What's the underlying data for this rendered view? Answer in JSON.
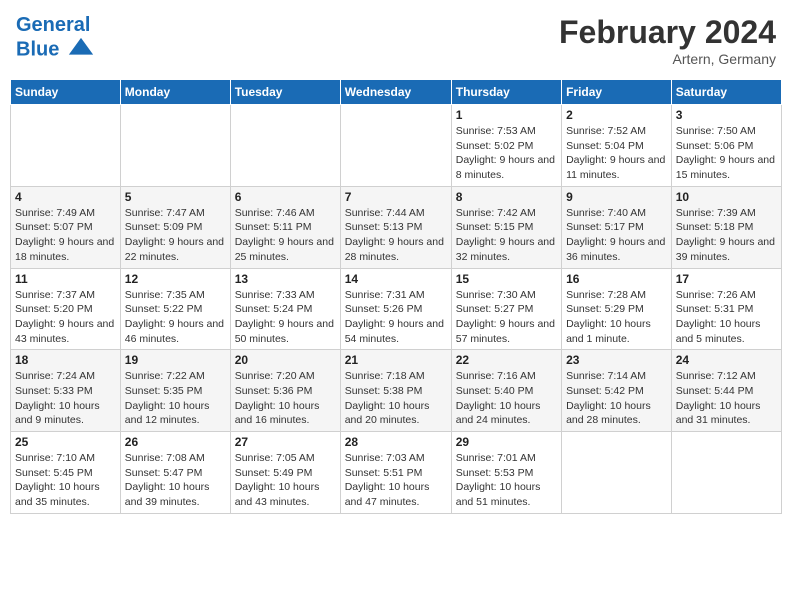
{
  "header": {
    "logo_line1": "General",
    "logo_line2": "Blue",
    "title": "February 2024",
    "subtitle": "Artern, Germany"
  },
  "weekdays": [
    "Sunday",
    "Monday",
    "Tuesday",
    "Wednesday",
    "Thursday",
    "Friday",
    "Saturday"
  ],
  "weeks": [
    [
      {
        "day": "",
        "sunrise": "",
        "sunset": "",
        "daylight": ""
      },
      {
        "day": "",
        "sunrise": "",
        "sunset": "",
        "daylight": ""
      },
      {
        "day": "",
        "sunrise": "",
        "sunset": "",
        "daylight": ""
      },
      {
        "day": "",
        "sunrise": "",
        "sunset": "",
        "daylight": ""
      },
      {
        "day": "1",
        "sunrise": "Sunrise: 7:53 AM",
        "sunset": "Sunset: 5:02 PM",
        "daylight": "Daylight: 9 hours and 8 minutes."
      },
      {
        "day": "2",
        "sunrise": "Sunrise: 7:52 AM",
        "sunset": "Sunset: 5:04 PM",
        "daylight": "Daylight: 9 hours and 11 minutes."
      },
      {
        "day": "3",
        "sunrise": "Sunrise: 7:50 AM",
        "sunset": "Sunset: 5:06 PM",
        "daylight": "Daylight: 9 hours and 15 minutes."
      }
    ],
    [
      {
        "day": "4",
        "sunrise": "Sunrise: 7:49 AM",
        "sunset": "Sunset: 5:07 PM",
        "daylight": "Daylight: 9 hours and 18 minutes."
      },
      {
        "day": "5",
        "sunrise": "Sunrise: 7:47 AM",
        "sunset": "Sunset: 5:09 PM",
        "daylight": "Daylight: 9 hours and 22 minutes."
      },
      {
        "day": "6",
        "sunrise": "Sunrise: 7:46 AM",
        "sunset": "Sunset: 5:11 PM",
        "daylight": "Daylight: 9 hours and 25 minutes."
      },
      {
        "day": "7",
        "sunrise": "Sunrise: 7:44 AM",
        "sunset": "Sunset: 5:13 PM",
        "daylight": "Daylight: 9 hours and 28 minutes."
      },
      {
        "day": "8",
        "sunrise": "Sunrise: 7:42 AM",
        "sunset": "Sunset: 5:15 PM",
        "daylight": "Daylight: 9 hours and 32 minutes."
      },
      {
        "day": "9",
        "sunrise": "Sunrise: 7:40 AM",
        "sunset": "Sunset: 5:17 PM",
        "daylight": "Daylight: 9 hours and 36 minutes."
      },
      {
        "day": "10",
        "sunrise": "Sunrise: 7:39 AM",
        "sunset": "Sunset: 5:18 PM",
        "daylight": "Daylight: 9 hours and 39 minutes."
      }
    ],
    [
      {
        "day": "11",
        "sunrise": "Sunrise: 7:37 AM",
        "sunset": "Sunset: 5:20 PM",
        "daylight": "Daylight: 9 hours and 43 minutes."
      },
      {
        "day": "12",
        "sunrise": "Sunrise: 7:35 AM",
        "sunset": "Sunset: 5:22 PM",
        "daylight": "Daylight: 9 hours and 46 minutes."
      },
      {
        "day": "13",
        "sunrise": "Sunrise: 7:33 AM",
        "sunset": "Sunset: 5:24 PM",
        "daylight": "Daylight: 9 hours and 50 minutes."
      },
      {
        "day": "14",
        "sunrise": "Sunrise: 7:31 AM",
        "sunset": "Sunset: 5:26 PM",
        "daylight": "Daylight: 9 hours and 54 minutes."
      },
      {
        "day": "15",
        "sunrise": "Sunrise: 7:30 AM",
        "sunset": "Sunset: 5:27 PM",
        "daylight": "Daylight: 9 hours and 57 minutes."
      },
      {
        "day": "16",
        "sunrise": "Sunrise: 7:28 AM",
        "sunset": "Sunset: 5:29 PM",
        "daylight": "Daylight: 10 hours and 1 minute."
      },
      {
        "day": "17",
        "sunrise": "Sunrise: 7:26 AM",
        "sunset": "Sunset: 5:31 PM",
        "daylight": "Daylight: 10 hours and 5 minutes."
      }
    ],
    [
      {
        "day": "18",
        "sunrise": "Sunrise: 7:24 AM",
        "sunset": "Sunset: 5:33 PM",
        "daylight": "Daylight: 10 hours and 9 minutes."
      },
      {
        "day": "19",
        "sunrise": "Sunrise: 7:22 AM",
        "sunset": "Sunset: 5:35 PM",
        "daylight": "Daylight: 10 hours and 12 minutes."
      },
      {
        "day": "20",
        "sunrise": "Sunrise: 7:20 AM",
        "sunset": "Sunset: 5:36 PM",
        "daylight": "Daylight: 10 hours and 16 minutes."
      },
      {
        "day": "21",
        "sunrise": "Sunrise: 7:18 AM",
        "sunset": "Sunset: 5:38 PM",
        "daylight": "Daylight: 10 hours and 20 minutes."
      },
      {
        "day": "22",
        "sunrise": "Sunrise: 7:16 AM",
        "sunset": "Sunset: 5:40 PM",
        "daylight": "Daylight: 10 hours and 24 minutes."
      },
      {
        "day": "23",
        "sunrise": "Sunrise: 7:14 AM",
        "sunset": "Sunset: 5:42 PM",
        "daylight": "Daylight: 10 hours and 28 minutes."
      },
      {
        "day": "24",
        "sunrise": "Sunrise: 7:12 AM",
        "sunset": "Sunset: 5:44 PM",
        "daylight": "Daylight: 10 hours and 31 minutes."
      }
    ],
    [
      {
        "day": "25",
        "sunrise": "Sunrise: 7:10 AM",
        "sunset": "Sunset: 5:45 PM",
        "daylight": "Daylight: 10 hours and 35 minutes."
      },
      {
        "day": "26",
        "sunrise": "Sunrise: 7:08 AM",
        "sunset": "Sunset: 5:47 PM",
        "daylight": "Daylight: 10 hours and 39 minutes."
      },
      {
        "day": "27",
        "sunrise": "Sunrise: 7:05 AM",
        "sunset": "Sunset: 5:49 PM",
        "daylight": "Daylight: 10 hours and 43 minutes."
      },
      {
        "day": "28",
        "sunrise": "Sunrise: 7:03 AM",
        "sunset": "Sunset: 5:51 PM",
        "daylight": "Daylight: 10 hours and 47 minutes."
      },
      {
        "day": "29",
        "sunrise": "Sunrise: 7:01 AM",
        "sunset": "Sunset: 5:53 PM",
        "daylight": "Daylight: 10 hours and 51 minutes."
      },
      {
        "day": "",
        "sunrise": "",
        "sunset": "",
        "daylight": ""
      },
      {
        "day": "",
        "sunrise": "",
        "sunset": "",
        "daylight": ""
      }
    ]
  ]
}
